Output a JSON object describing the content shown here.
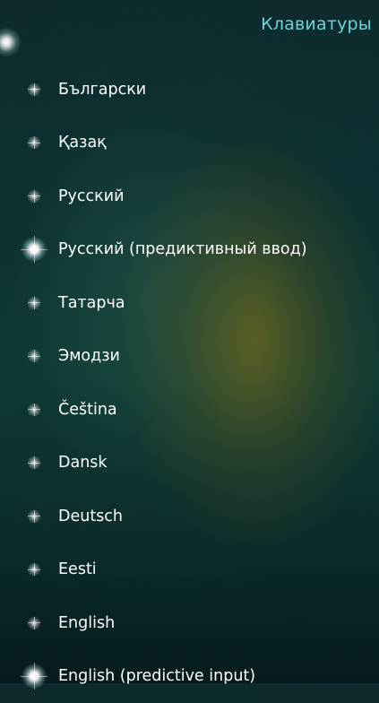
{
  "header": {
    "title": "Клавиатуры"
  },
  "keyboards": [
    {
      "label": "Български",
      "selected": false
    },
    {
      "label": "Қазақ",
      "selected": false
    },
    {
      "label": "Русский",
      "selected": false
    },
    {
      "label": "Русский (предиктивный ввод)",
      "selected": true
    },
    {
      "label": "Татарча",
      "selected": false
    },
    {
      "label": "Эмодзи",
      "selected": false
    },
    {
      "label": "Čeština",
      "selected": false
    },
    {
      "label": "Dansk",
      "selected": false
    },
    {
      "label": "Deutsch",
      "selected": false
    },
    {
      "label": "Eesti",
      "selected": false
    },
    {
      "label": "English",
      "selected": false
    },
    {
      "label": "English (predictive input)",
      "selected": true
    }
  ],
  "colors": {
    "title": "#6fd3d8",
    "text": "#ffffff"
  }
}
